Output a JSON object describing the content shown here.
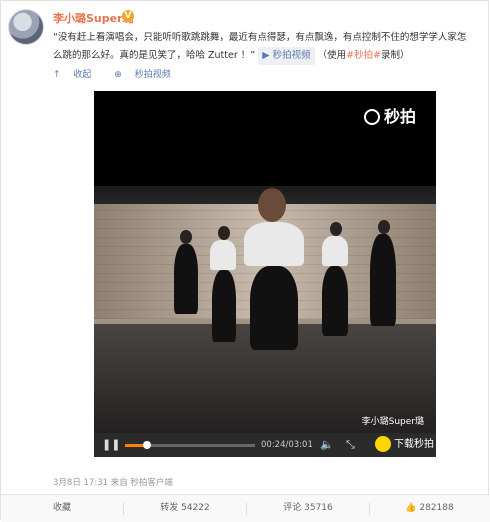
{
  "post": {
    "username": "李小璐Super璐",
    "verified_badge": "V",
    "text_main": "“没有赶上看演唱会，只能听听歌跳跳舞，最近有点得瑟，有点飘逸，有点控制不住的想学学人家怎么跳的那么好。真的是见笑了，哈哈 Zutter ！”",
    "video_link_label": "秒拍视频",
    "text_suffix_prefix": "（使用",
    "text_suffix_link": "#秒拍#",
    "text_suffix_end": "录制）",
    "collect_label": "收起",
    "view_large_label": "秒拍视频"
  },
  "video": {
    "brand_label": "秒拍",
    "watermark": "李小璐Super璐",
    "time": "00:24/03:01",
    "progress": 0.17,
    "download_label": "下载秒拍"
  },
  "meta": {
    "date": "3月8日 17:31",
    "source": "来自 秒拍客户端"
  },
  "bottom_bar": {
    "favorite": "收藏",
    "repost": "转发 54222",
    "comment": "评论 35716",
    "like": "282188"
  },
  "colors": {
    "accent": "#eb7350",
    "link": "#5a7ab6",
    "progress": "#ff8200",
    "download": "#ffd400"
  },
  "icons": [
    "collapse-icon",
    "zoom-icon",
    "video-icon",
    "play-pause-icon",
    "volume-icon",
    "fullscreen-icon",
    "miaopai-icon",
    "like-icon"
  ]
}
